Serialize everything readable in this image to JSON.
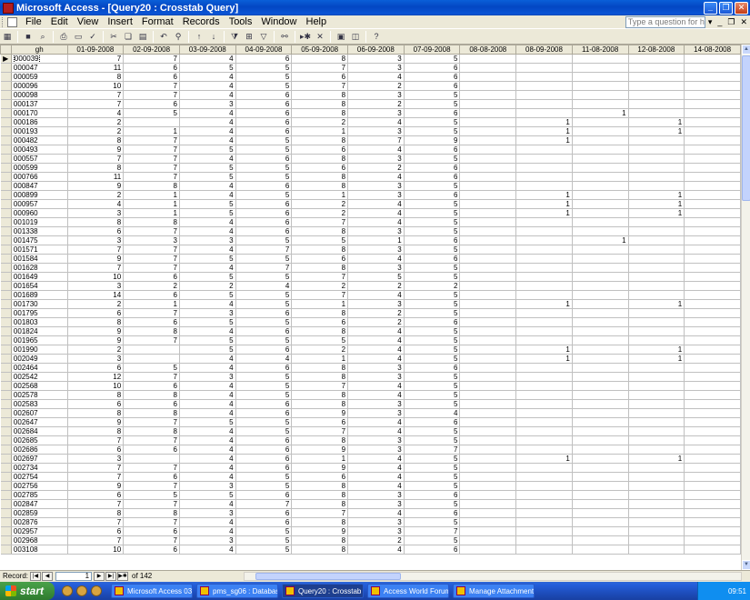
{
  "window": {
    "title": "Microsoft Access - [Query20 : Crosstab Query]"
  },
  "menu": {
    "items": [
      "File",
      "Edit",
      "View",
      "Insert",
      "Format",
      "Records",
      "Tools",
      "Window",
      "Help"
    ],
    "ask_placeholder": "Type a question for help"
  },
  "grid": {
    "columns": [
      "gh",
      "01-09-2008",
      "02-09-2008",
      "03-09-2008",
      "04-09-2008",
      "05-09-2008",
      "06-09-2008",
      "07-09-2008",
      "08-08-2008",
      "08-09-2008",
      "11-08-2008",
      "12-08-2008",
      "14-08-2008"
    ],
    "rows": [
      [
        "000039",
        "7",
        "7",
        "4",
        "6",
        "8",
        "3",
        "5",
        "",
        "",
        "",
        "",
        ""
      ],
      [
        "000047",
        "11",
        "6",
        "5",
        "5",
        "7",
        "3",
        "6",
        "",
        "",
        "",
        "",
        ""
      ],
      [
        "000059",
        "8",
        "6",
        "4",
        "5",
        "6",
        "4",
        "6",
        "",
        "",
        "",
        "",
        ""
      ],
      [
        "000096",
        "10",
        "7",
        "4",
        "5",
        "7",
        "2",
        "6",
        "",
        "",
        "",
        "",
        ""
      ],
      [
        "000098",
        "7",
        "7",
        "4",
        "6",
        "8",
        "3",
        "5",
        "",
        "",
        "",
        "",
        ""
      ],
      [
        "000137",
        "7",
        "6",
        "3",
        "6",
        "8",
        "2",
        "5",
        "",
        "",
        "",
        "",
        ""
      ],
      [
        "000170",
        "4",
        "5",
        "4",
        "6",
        "8",
        "3",
        "6",
        "",
        "",
        "1",
        "",
        ""
      ],
      [
        "000186",
        "2",
        "",
        "4",
        "6",
        "2",
        "4",
        "5",
        "",
        "1",
        "",
        "1",
        ""
      ],
      [
        "000193",
        "2",
        "1",
        "4",
        "6",
        "1",
        "3",
        "5",
        "",
        "1",
        "",
        "1",
        ""
      ],
      [
        "000482",
        "8",
        "7",
        "4",
        "5",
        "8",
        "7",
        "9",
        "",
        "1",
        "",
        "",
        ""
      ],
      [
        "000493",
        "9",
        "7",
        "5",
        "5",
        "6",
        "4",
        "6",
        "",
        "",
        "",
        "",
        ""
      ],
      [
        "000557",
        "7",
        "7",
        "4",
        "6",
        "8",
        "3",
        "5",
        "",
        "",
        "",
        "",
        ""
      ],
      [
        "000599",
        "8",
        "7",
        "5",
        "5",
        "6",
        "2",
        "6",
        "",
        "",
        "",
        "",
        ""
      ],
      [
        "000766",
        "11",
        "7",
        "5",
        "5",
        "8",
        "4",
        "6",
        "",
        "",
        "",
        "",
        ""
      ],
      [
        "000847",
        "9",
        "8",
        "4",
        "6",
        "8",
        "3",
        "5",
        "",
        "",
        "",
        "",
        ""
      ],
      [
        "000899",
        "2",
        "1",
        "4",
        "5",
        "1",
        "3",
        "6",
        "",
        "1",
        "",
        "1",
        ""
      ],
      [
        "000957",
        "4",
        "1",
        "5",
        "6",
        "2",
        "4",
        "5",
        "",
        "1",
        "",
        "1",
        ""
      ],
      [
        "000960",
        "3",
        "1",
        "5",
        "6",
        "2",
        "4",
        "5",
        "",
        "1",
        "",
        "1",
        ""
      ],
      [
        "001019",
        "8",
        "8",
        "4",
        "6",
        "7",
        "4",
        "5",
        "",
        "",
        "",
        "",
        ""
      ],
      [
        "001338",
        "6",
        "7",
        "4",
        "6",
        "8",
        "3",
        "5",
        "",
        "",
        "",
        "",
        ""
      ],
      [
        "001475",
        "3",
        "3",
        "3",
        "5",
        "5",
        "1",
        "6",
        "",
        "",
        "1",
        "",
        ""
      ],
      [
        "001571",
        "7",
        "7",
        "4",
        "7",
        "8",
        "3",
        "5",
        "",
        "",
        "",
        "",
        ""
      ],
      [
        "001584",
        "9",
        "7",
        "5",
        "5",
        "6",
        "4",
        "6",
        "",
        "",
        "",
        "",
        ""
      ],
      [
        "001628",
        "7",
        "7",
        "4",
        "7",
        "8",
        "3",
        "5",
        "",
        "",
        "",
        "",
        ""
      ],
      [
        "001649",
        "10",
        "6",
        "5",
        "5",
        "7",
        "5",
        "5",
        "",
        "",
        "",
        "",
        ""
      ],
      [
        "001654",
        "3",
        "2",
        "2",
        "4",
        "2",
        "2",
        "2",
        "",
        "",
        "",
        "",
        ""
      ],
      [
        "001689",
        "14",
        "6",
        "5",
        "5",
        "7",
        "4",
        "5",
        "",
        "",
        "",
        "",
        ""
      ],
      [
        "001730",
        "2",
        "1",
        "4",
        "5",
        "1",
        "3",
        "5",
        "",
        "1",
        "",
        "1",
        ""
      ],
      [
        "001795",
        "6",
        "7",
        "3",
        "6",
        "8",
        "2",
        "5",
        "",
        "",
        "",
        "",
        ""
      ],
      [
        "001803",
        "8",
        "6",
        "5",
        "5",
        "6",
        "2",
        "6",
        "",
        "",
        "",
        "",
        ""
      ],
      [
        "001824",
        "9",
        "8",
        "4",
        "6",
        "8",
        "4",
        "5",
        "",
        "",
        "",
        "",
        ""
      ],
      [
        "001965",
        "9",
        "7",
        "5",
        "5",
        "5",
        "4",
        "5",
        "",
        "",
        "",
        "",
        ""
      ],
      [
        "001990",
        "2",
        "",
        "5",
        "6",
        "2",
        "4",
        "5",
        "",
        "1",
        "",
        "1",
        ""
      ],
      [
        "002049",
        "3",
        "",
        "4",
        "4",
        "1",
        "4",
        "5",
        "",
        "1",
        "",
        "1",
        ""
      ],
      [
        "002464",
        "6",
        "5",
        "4",
        "6",
        "8",
        "3",
        "6",
        "",
        "",
        "",
        "",
        ""
      ],
      [
        "002542",
        "12",
        "7",
        "3",
        "5",
        "8",
        "3",
        "5",
        "",
        "",
        "",
        "",
        ""
      ],
      [
        "002568",
        "10",
        "6",
        "4",
        "5",
        "7",
        "4",
        "5",
        "",
        "",
        "",
        "",
        ""
      ],
      [
        "002578",
        "8",
        "8",
        "4",
        "5",
        "8",
        "4",
        "5",
        "",
        "",
        "",
        "",
        ""
      ],
      [
        "002583",
        "6",
        "6",
        "4",
        "6",
        "8",
        "3",
        "5",
        "",
        "",
        "",
        "",
        ""
      ],
      [
        "002607",
        "8",
        "8",
        "4",
        "6",
        "9",
        "3",
        "4",
        "",
        "",
        "",
        "",
        ""
      ],
      [
        "002647",
        "9",
        "7",
        "5",
        "5",
        "6",
        "4",
        "6",
        "",
        "",
        "",
        "",
        ""
      ],
      [
        "002684",
        "8",
        "8",
        "4",
        "5",
        "7",
        "4",
        "5",
        "",
        "",
        "",
        "",
        ""
      ],
      [
        "002685",
        "7",
        "7",
        "4",
        "6",
        "8",
        "3",
        "5",
        "",
        "",
        "",
        "",
        ""
      ],
      [
        "002686",
        "6",
        "6",
        "4",
        "6",
        "9",
        "3",
        "7",
        "",
        "",
        "",
        "",
        ""
      ],
      [
        "002697",
        "3",
        "",
        "4",
        "6",
        "1",
        "4",
        "5",
        "",
        "1",
        "",
        "1",
        ""
      ],
      [
        "002734",
        "7",
        "7",
        "4",
        "6",
        "9",
        "4",
        "5",
        "",
        "",
        "",
        "",
        ""
      ],
      [
        "002754",
        "7",
        "6",
        "4",
        "5",
        "6",
        "4",
        "5",
        "",
        "",
        "",
        "",
        ""
      ],
      [
        "002756",
        "9",
        "7",
        "3",
        "5",
        "8",
        "4",
        "5",
        "",
        "",
        "",
        "",
        ""
      ],
      [
        "002785",
        "6",
        "5",
        "5",
        "6",
        "8",
        "3",
        "6",
        "",
        "",
        "",
        "",
        ""
      ],
      [
        "002847",
        "7",
        "7",
        "4",
        "7",
        "8",
        "3",
        "5",
        "",
        "",
        "",
        "",
        ""
      ],
      [
        "002859",
        "8",
        "8",
        "3",
        "6",
        "7",
        "4",
        "6",
        "",
        "",
        "",
        "",
        ""
      ],
      [
        "002876",
        "7",
        "7",
        "4",
        "6",
        "8",
        "3",
        "5",
        "",
        "",
        "",
        "",
        ""
      ],
      [
        "002957",
        "6",
        "6",
        "4",
        "5",
        "9",
        "3",
        "7",
        "",
        "",
        "",
        "",
        ""
      ],
      [
        "002968",
        "7",
        "7",
        "3",
        "5",
        "8",
        "2",
        "5",
        "",
        "",
        "",
        "",
        ""
      ],
      [
        "003108",
        "10",
        "6",
        "4",
        "5",
        "8",
        "4",
        "6",
        "",
        "",
        "",
        "",
        ""
      ]
    ]
  },
  "nav": {
    "record_label": "Record:",
    "current_record": "1",
    "of_text": "of 142"
  },
  "taskbar": {
    "start_label": "start",
    "tasks": [
      "Microsoft Access 03",
      "pms_sg06 : Database...",
      "Query20 : Crosstab ...",
      "Access World Forums...",
      "Manage Attachments..."
    ],
    "active_task": 2,
    "clock": "09:51"
  }
}
